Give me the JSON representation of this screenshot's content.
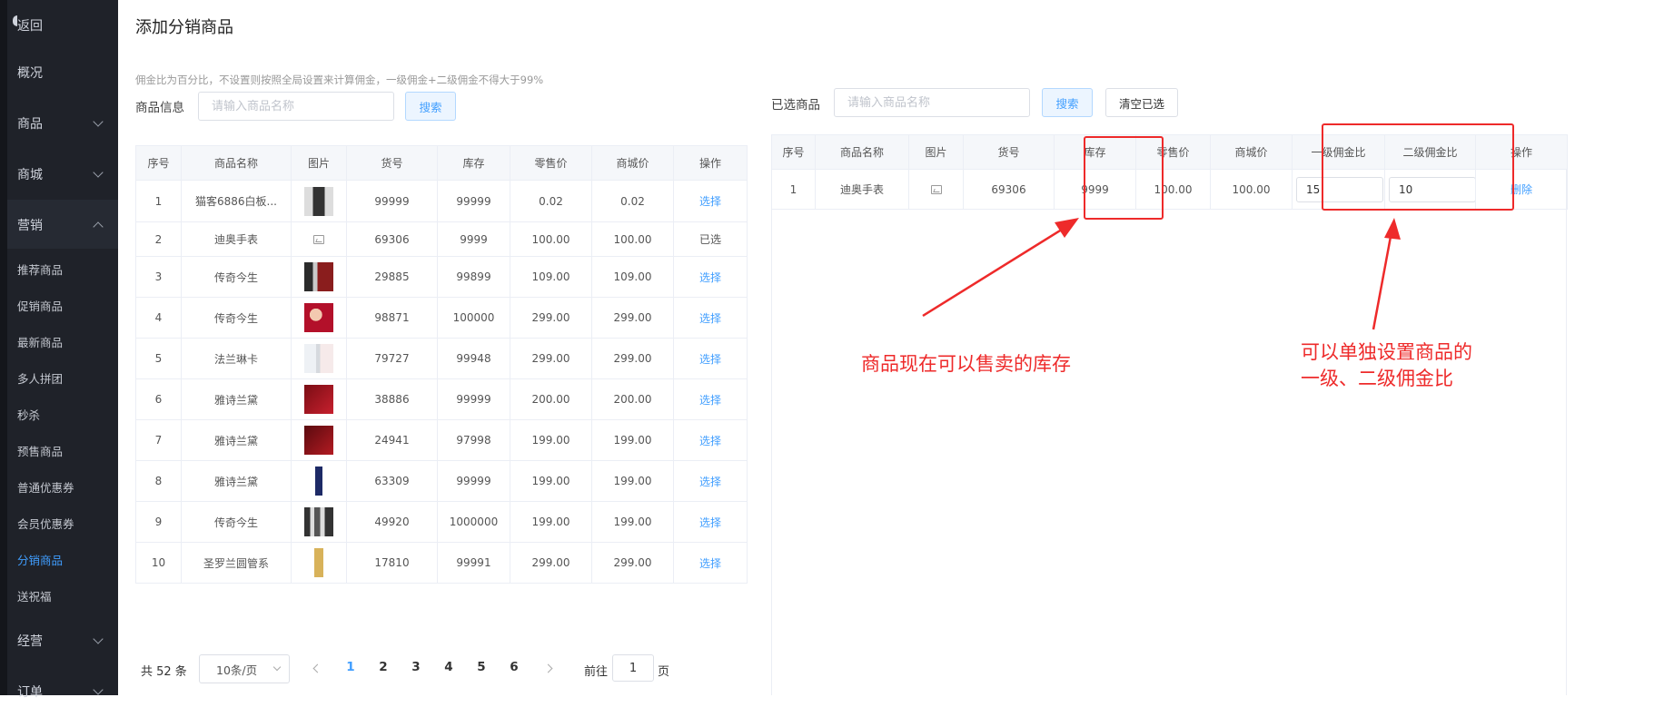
{
  "sidebar": {
    "top_items": [
      {
        "label": "返回"
      },
      {
        "label": "概况"
      },
      {
        "label": "商品"
      },
      {
        "label": "商城"
      },
      {
        "label": "营销"
      }
    ],
    "marketing_sub": [
      {
        "label": "推荐商品"
      },
      {
        "label": "促销商品"
      },
      {
        "label": "最新商品"
      },
      {
        "label": "多人拼团"
      },
      {
        "label": "秒杀"
      },
      {
        "label": "预售商品"
      },
      {
        "label": "普通优惠券"
      },
      {
        "label": "会员优惠券"
      },
      {
        "label": "分销商品",
        "active": true
      },
      {
        "label": "送祝福"
      }
    ],
    "bottom_items": [
      {
        "label": "经营"
      },
      {
        "label": "订单"
      }
    ],
    "active_color": "#409eff"
  },
  "page": {
    "title": "添加分销商品",
    "hint": "佣金比为百分比，不设置则按照全局设置来计算佣金，一级佣金+二级佣金不得大于99%"
  },
  "left": {
    "label": "商品信息",
    "search_placeholder": "请输入商品名称",
    "search_button": "搜索",
    "columns": [
      "序号",
      "商品名称",
      "图片",
      "货号",
      "库存",
      "零售价",
      "商城价",
      "操作"
    ],
    "rows": [
      {
        "no": "1",
        "name": "猫客6886白板...",
        "image": "white-pen-photo",
        "sku": "99999",
        "stock": "99999",
        "retail": "0.02",
        "mall": "0.02",
        "action": "选择",
        "selected": false
      },
      {
        "no": "2",
        "name": "迪奥手表",
        "image": "broken-image-icon",
        "sku": "69306",
        "stock": "9999",
        "retail": "100.00",
        "mall": "100.00",
        "action": "已选",
        "selected": true
      },
      {
        "no": "3",
        "name": "传奇今生",
        "image": "skincare-set-photo",
        "sku": "29885",
        "stock": "99899",
        "retail": "109.00",
        "mall": "109.00",
        "action": "选择",
        "selected": false
      },
      {
        "no": "4",
        "name": "传奇今生",
        "image": "model-promo-photo",
        "sku": "98871",
        "stock": "100000",
        "retail": "299.00",
        "mall": "299.00",
        "action": "选择",
        "selected": false
      },
      {
        "no": "5",
        "name": "法兰琳卡",
        "image": "serum-bottles-photo",
        "sku": "79727",
        "stock": "99948",
        "retail": "299.00",
        "mall": "299.00",
        "action": "选择",
        "selected": false
      },
      {
        "no": "6",
        "name": "雅诗兰黛",
        "image": "red-lipstick-banner-photo",
        "sku": "38886",
        "stock": "99999",
        "retail": "200.00",
        "mall": "200.00",
        "action": "选择",
        "selected": false
      },
      {
        "no": "7",
        "name": "雅诗兰黛",
        "image": "red-gift-box-photo",
        "sku": "24941",
        "stock": "97998",
        "retail": "199.00",
        "mall": "199.00",
        "action": "选择",
        "selected": false
      },
      {
        "no": "8",
        "name": "雅诗兰黛",
        "image": "lipstick-photo",
        "sku": "63309",
        "stock": "99999",
        "retail": "199.00",
        "mall": "199.00",
        "action": "选择",
        "selected": false
      },
      {
        "no": "9",
        "name": "传奇今生",
        "image": "bottles-set-photo",
        "sku": "49920",
        "stock": "1000000",
        "retail": "199.00",
        "mall": "199.00",
        "action": "选择",
        "selected": false
      },
      {
        "no": "10",
        "name": "圣罗兰圆管系",
        "image": "gold-lipstick-photo",
        "sku": "17810",
        "stock": "99991",
        "retail": "299.00",
        "mall": "299.00",
        "action": "选择",
        "selected": false
      }
    ],
    "pagination": {
      "total": "共 52 条",
      "page_size": "10条/页",
      "pages": [
        "1",
        "2",
        "3",
        "4",
        "5",
        "6"
      ],
      "current": "1",
      "goto_prefix": "前往",
      "goto_value": "1",
      "goto_suffix": "页"
    }
  },
  "right": {
    "label": "已选商品",
    "search_placeholder": "请输入商品名称",
    "search_button": "搜索",
    "clear_button": "清空已选",
    "columns": [
      "序号",
      "商品名称",
      "图片",
      "货号",
      "库存",
      "零售价",
      "商城价",
      "一级佣金比",
      "二级佣金比",
      "操作"
    ],
    "rows": [
      {
        "no": "1",
        "name": "迪奥手表",
        "image": "broken-image-icon",
        "sku": "69306",
        "stock": "9999",
        "retail": "100.00",
        "mall": "100.00",
        "level1": "15",
        "level2": "10",
        "action": "删除"
      }
    ]
  },
  "annotations": {
    "stock_note": "商品现在可以售卖的库存",
    "commission_note_line1": "可以单独设置商品的",
    "commission_note_line2": "一级、二级佣金比",
    "color": "#ee2a2a"
  }
}
